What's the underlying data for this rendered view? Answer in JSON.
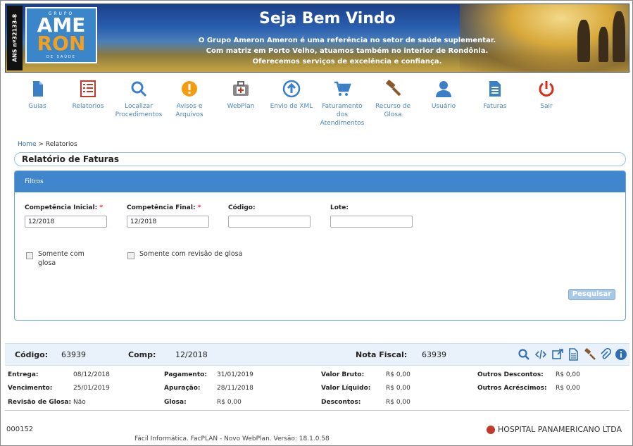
{
  "banner": {
    "ans": "ANS nº32133-8",
    "logo_top": "GRUPO",
    "logo_line1": "AME",
    "logo_line2": "RON",
    "logo_bottom": "DE SAÚDE",
    "welcome": "Seja Bem Vindo",
    "tagline1": "O Grupo Ameron Ameron é uma referência no setor de saúde suplementar.",
    "tagline2": "Com matriz em Porto Velho, atuamos também no interior de Rondônia.",
    "tagline3": "Oferecemos serviços de excelência e confiança."
  },
  "nav": {
    "items": [
      {
        "label": "Guias",
        "icon": "document-icon",
        "color": "#3a7fc8"
      },
      {
        "label": "Relatorios",
        "icon": "report-icon",
        "color": "#c0392b"
      },
      {
        "label": "Localizar Procedimentos",
        "icon": "search-icon",
        "color": "#3a7fc8"
      },
      {
        "label": "Avisos e Arquivos",
        "icon": "alert-icon",
        "color": "#f39c12"
      },
      {
        "label": "WebPlan",
        "icon": "medkit-icon",
        "color": "#888888"
      },
      {
        "label": "Envio de XML",
        "icon": "upload-icon",
        "color": "#3a7fc8"
      },
      {
        "label": "Faturamento dos Atendimentos",
        "icon": "cart-icon",
        "color": "#3a7fc8"
      },
      {
        "label": "Recurso de Glosa",
        "icon": "gavel-icon",
        "color": "#8b5a2b"
      },
      {
        "label": "Usuário",
        "icon": "user-icon",
        "color": "#3a7fc8"
      },
      {
        "label": "Faturas",
        "icon": "invoice-icon",
        "color": "#3a7fc8"
      },
      {
        "label": "Sair",
        "icon": "power-icon",
        "color": "#d62c1a"
      }
    ]
  },
  "breadcrumb": {
    "home": "Home",
    "sep": ">",
    "current": "Relatorios"
  },
  "page_title": "Relatório de Faturas",
  "filters": {
    "header": "Filtros",
    "comp_inicial_label": "Competência Inicial:",
    "comp_inicial_value": "12/2018",
    "comp_final_label": "Competência Final:",
    "comp_final_value": "12/2018",
    "codigo_label": "Código:",
    "codigo_value": "",
    "lote_label": "Lote:",
    "lote_value": "",
    "required_mark": "*",
    "chk_glosa_label": "Somente com glosa",
    "chk_revisao_label": "Somente com revisão de glosa",
    "search_button": "Pesquisar"
  },
  "record": {
    "codigo_label": "Código:",
    "codigo_value": "63939",
    "comp_label": "Comp:",
    "comp_value": "12/2018",
    "nf_label": "Nota Fiscal:",
    "nf_value": "63939"
  },
  "details": {
    "entrega_label": "Entrega:",
    "entrega_value": "08/12/2018",
    "vencimento_label": "Vencimento:",
    "vencimento_value": "25/01/2019",
    "revisao_label": "Revisão de Glosa:",
    "revisao_value": "Não",
    "pagamento_label": "Pagamento:",
    "pagamento_value": "31/01/2019",
    "apuracao_label": "Apuração:",
    "apuracao_value": "28/11/2018",
    "glosa_label": "Glosa:",
    "glosa_value": "R$ 0,00",
    "bruto_label": "Valor Bruto:",
    "bruto_value": "R$ 0,00",
    "liquido_label": "Valor Líquido:",
    "liquido_value": "R$ 0,00",
    "descontos_label": "Descontos:",
    "descontos_value": "R$ 0,00",
    "outros_desc_label": "Outros Descontos:",
    "outros_desc_value": "R$ 0,00",
    "outros_acr_label": "Outros Acréscimos:",
    "outros_acr_value": "R$ 0,00"
  },
  "footer": {
    "code": "000152",
    "provider": "HOSPITAL PANAMERICANO LTDA",
    "version": "Fácil Informática. FacPLAN - Novo WebPlan. Versão: 18.1.0.58"
  }
}
